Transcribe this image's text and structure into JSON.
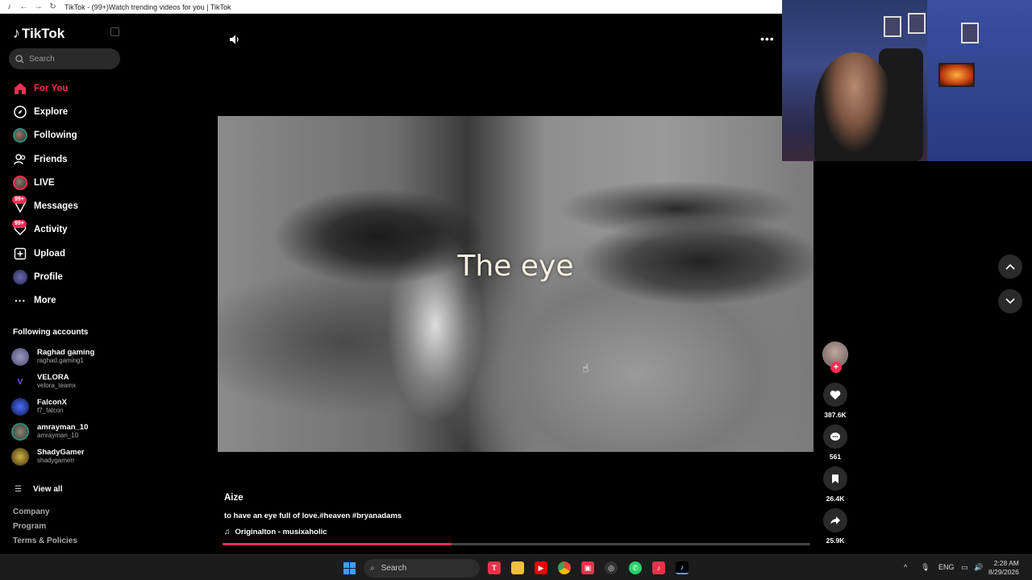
{
  "browser": {
    "tab_title": "TikTok - (99+)Watch trending videos for you | TikTok"
  },
  "app": {
    "logo_text": "TikTok"
  },
  "search": {
    "placeholder": "Search"
  },
  "nav": [
    {
      "label": "For You",
      "icon": "home-icon",
      "active": true
    },
    {
      "label": "Explore",
      "icon": "compass-icon"
    },
    {
      "label": "Following",
      "icon": "following-avatar"
    },
    {
      "label": "Friends",
      "icon": "friends-icon"
    },
    {
      "label": "LIVE",
      "icon": "live-avatar"
    },
    {
      "label": "Messages",
      "icon": "messages-icon",
      "badge": "99+"
    },
    {
      "label": "Activity",
      "icon": "activity-icon",
      "badge": "99+"
    },
    {
      "label": "Upload",
      "icon": "upload-icon"
    },
    {
      "label": "Profile",
      "icon": "profile-avatar"
    },
    {
      "label": "More",
      "icon": "more-dots-icon"
    }
  ],
  "following_accounts": {
    "title": "Following accounts",
    "items": [
      {
        "name": "Raghad gaming",
        "handle": "raghad.gaming1"
      },
      {
        "name": "VELORA",
        "handle": "velora_teamx"
      },
      {
        "name": "FalconX",
        "handle": "f7_falcon"
      },
      {
        "name": "amrayman_10",
        "handle": "amrayman_10"
      },
      {
        "name": "ShadyGamer",
        "handle": "shadygamerr"
      }
    ],
    "view_all": "View all"
  },
  "footer": {
    "company": "Company",
    "program": "Program",
    "terms": "Terms & Policies"
  },
  "video": {
    "caption": "The eye",
    "author": "Aize",
    "description": "to have an eye full of love.#heaven #bryanadams",
    "music": "Originalton - musixaholic",
    "progress": 0.39
  },
  "actions": {
    "likes": "387.6K",
    "comments": "561",
    "saves": "26.4K",
    "shares": "25.9K"
  },
  "taskbar": {
    "search_label": "Search",
    "lang": "ENG",
    "time": "2:28 AM",
    "date": "8/29/2026"
  },
  "colors": {
    "accent": "#fe2c55",
    "background": "#000000"
  }
}
